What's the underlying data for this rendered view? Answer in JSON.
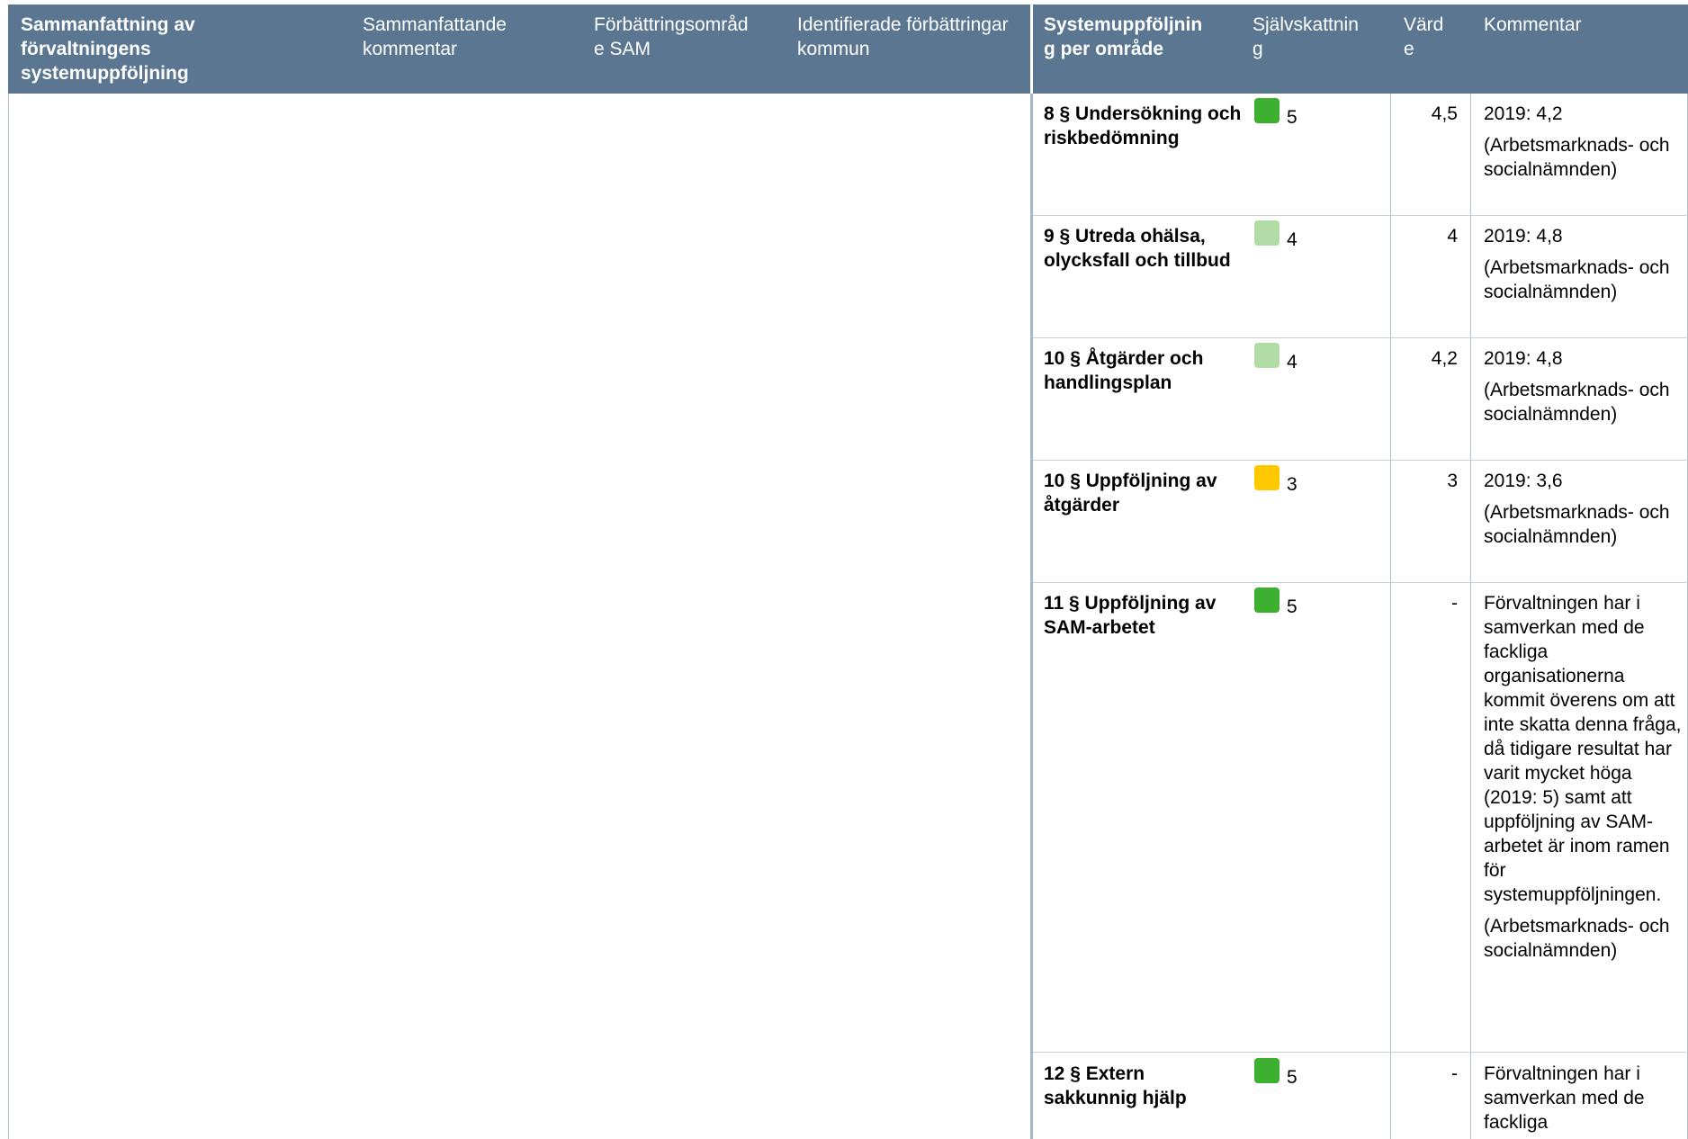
{
  "header": {
    "summary_title": "Sammanfattning av förvaltningens systemuppföljning",
    "summary_comment": "Sammanfattande kommentar",
    "improvement_area": "Förbättringsområde SAM",
    "identified_improvements": "Identifierade förbättringar kommun",
    "area_title": "Systemuppföljning per område",
    "self_assessment": "Självskattning",
    "value": "Värde",
    "comment": "Kommentar"
  },
  "colors": {
    "header_bg": "#5a7690",
    "green_dark": "#3cb02f",
    "green_light": "#b2dda7",
    "yellow": "#ffc800"
  },
  "rows": [
    {
      "area": "8 § Undersökning och riskbedömning",
      "indicator_color": "#3cb02f",
      "score": "5",
      "value": "4,5",
      "comment": [
        "2019: 4,2",
        "(Arbetsmarknads- och socialnämnden)"
      ]
    },
    {
      "area": "9 § Utreda ohälsa, olycksfall och tillbud",
      "indicator_color": "#b2dda7",
      "score": "4",
      "value": "4",
      "comment": [
        "2019: 4,8",
        "(Arbetsmarknads- och socialnämnden)"
      ]
    },
    {
      "area": "10 § Åtgärder och handlingsplan",
      "indicator_color": "#b2dda7",
      "score": "4",
      "value": "4,2",
      "comment": [
        "2019: 4,8",
        "(Arbetsmarknads- och socialnämnden)"
      ]
    },
    {
      "area": "10 § Uppföljning av åtgärder",
      "indicator_color": "#ffc800",
      "score": "3",
      "value": "3",
      "comment": [
        "2019: 3,6",
        "(Arbetsmarknads- och socialnämnden)"
      ]
    },
    {
      "area": "11 § Uppföljning av SAM-arbetet",
      "indicator_color": "#3cb02f",
      "score": "5",
      "value": "-",
      "comment": [
        "Förvaltningen har i samverkan med de fackliga organisationerna kommit överens om att inte skatta denna fråga, då tidigare resultat har varit mycket höga (2019: 5) samt att uppföljning av SAM-arbetet är inom ramen för systemuppföljningen.",
        "(Arbetsmarknads- och socialnämnden)"
      ]
    },
    {
      "area": "12 § Extern sakkunnig hjälp",
      "indicator_color": "#3cb02f",
      "score": "5",
      "value": "-",
      "comment": [
        "Förvaltningen har i samverkan med de fackliga"
      ]
    }
  ]
}
